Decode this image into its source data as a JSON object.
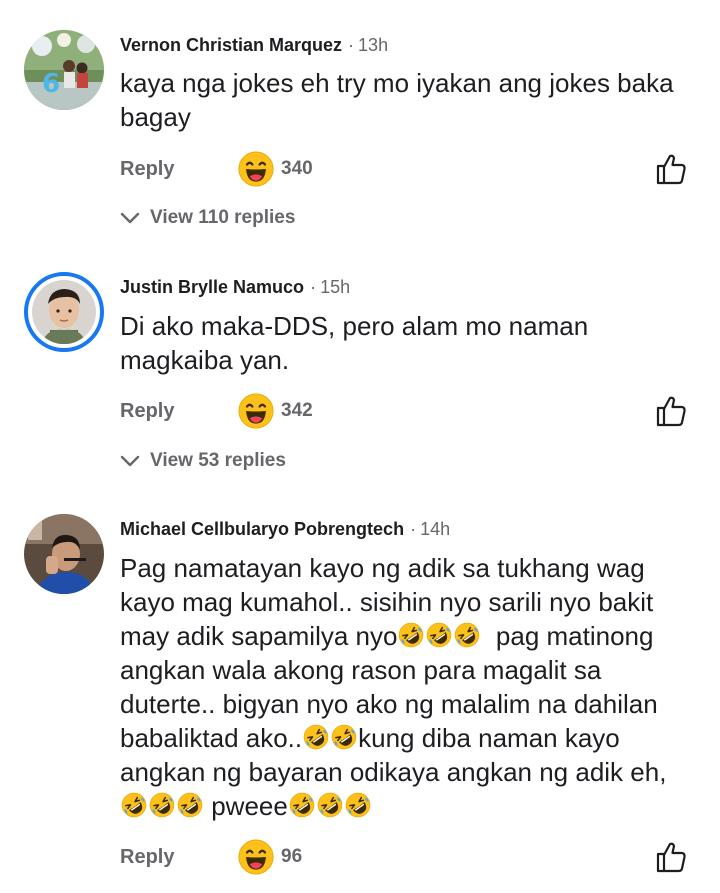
{
  "comments": [
    {
      "author": "Vernon Christian Marquez",
      "time": "13h",
      "body": "kaya nga jokes eh try mo iyakan ang jokes baka\nbagay",
      "reply_label": "Reply",
      "reaction_count": "340",
      "view_replies": "View 110 replies"
    },
    {
      "author": "Justin Brylle Namuco",
      "time": "15h",
      "body": "Di ako maka-DDS, pero alam mo naman\nmagkaiba yan.",
      "reply_label": "Reply",
      "reaction_count": "342",
      "view_replies": "View 53 replies"
    },
    {
      "author": "Michael Cellbularyo Pobrengtech",
      "time": "14h",
      "body_parts": [
        "Pag namatayan kayo ng adik sa tukhang wag\nkayo mag kumahol.. sisihin nyo sarili nyo bakit\nmay adik sapamilya nyo",
        "  pag matinong\nangkan wala akong rason para magalit sa\nduterte.. bigyan nyo ako ng malalim na dahilan\nbabaliktad ako..",
        "kung diba naman kayo\nangkan ng bayaran odikaya angkan ng adik eh,\n",
        " pweee"
      ],
      "reply_label": "Reply",
      "reaction_count": "96"
    }
  ],
  "icons": {
    "reaction": "laughing-face-emoji",
    "like": "thumbs-up-outline-icon",
    "inline_emoji": "rolling-on-floor-laughing-emoji",
    "chevron": "chevron-down-icon"
  },
  "colors": {
    "text_primary": "#1c1e21",
    "text_secondary": "#65676b",
    "story_ring": "#1877f2",
    "emoji_yellow": "#fcc21b"
  }
}
